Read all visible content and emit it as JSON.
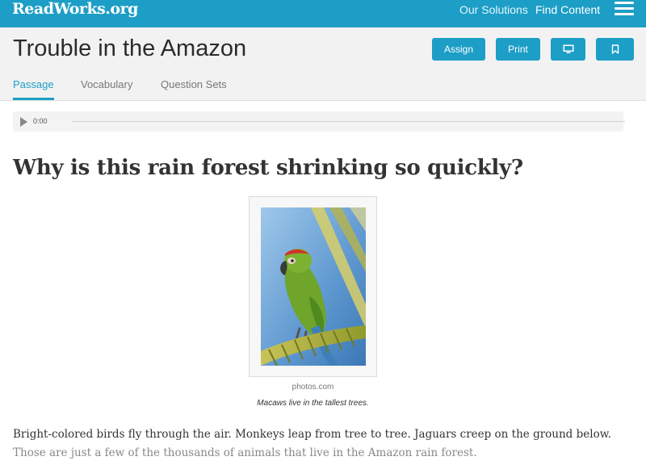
{
  "nav": {
    "logo": "ReadWorks.org",
    "links": [
      "Our Solutions",
      "Find Content"
    ],
    "menu_icon": "hamburger-icon"
  },
  "header": {
    "title": "Trouble in the Amazon",
    "buttons": {
      "assign": "Assign",
      "print": "Print",
      "present_icon": "monitor-icon",
      "bookmark_icon": "bookmark-icon"
    },
    "tabs": [
      "Passage",
      "Vocabulary",
      "Question Sets"
    ],
    "active_tab": "Passage"
  },
  "audio": {
    "time": "0:00",
    "play_icon": "play-icon"
  },
  "article": {
    "heading": "Why is this rain forest shrinking so quickly?",
    "figure": {
      "credit": "photos.com",
      "caption": "Macaws live in the tallest trees."
    },
    "lines": [
      "Bright-colored birds fly through the air. Monkeys leap from tree to tree. Jaguars creep on the ground below.",
      "Those are just a few of the thousands of animals that live in the Amazon rain forest."
    ]
  },
  "colors": {
    "brand": "#1c9ec6",
    "header_bg": "#f2f2f2"
  }
}
